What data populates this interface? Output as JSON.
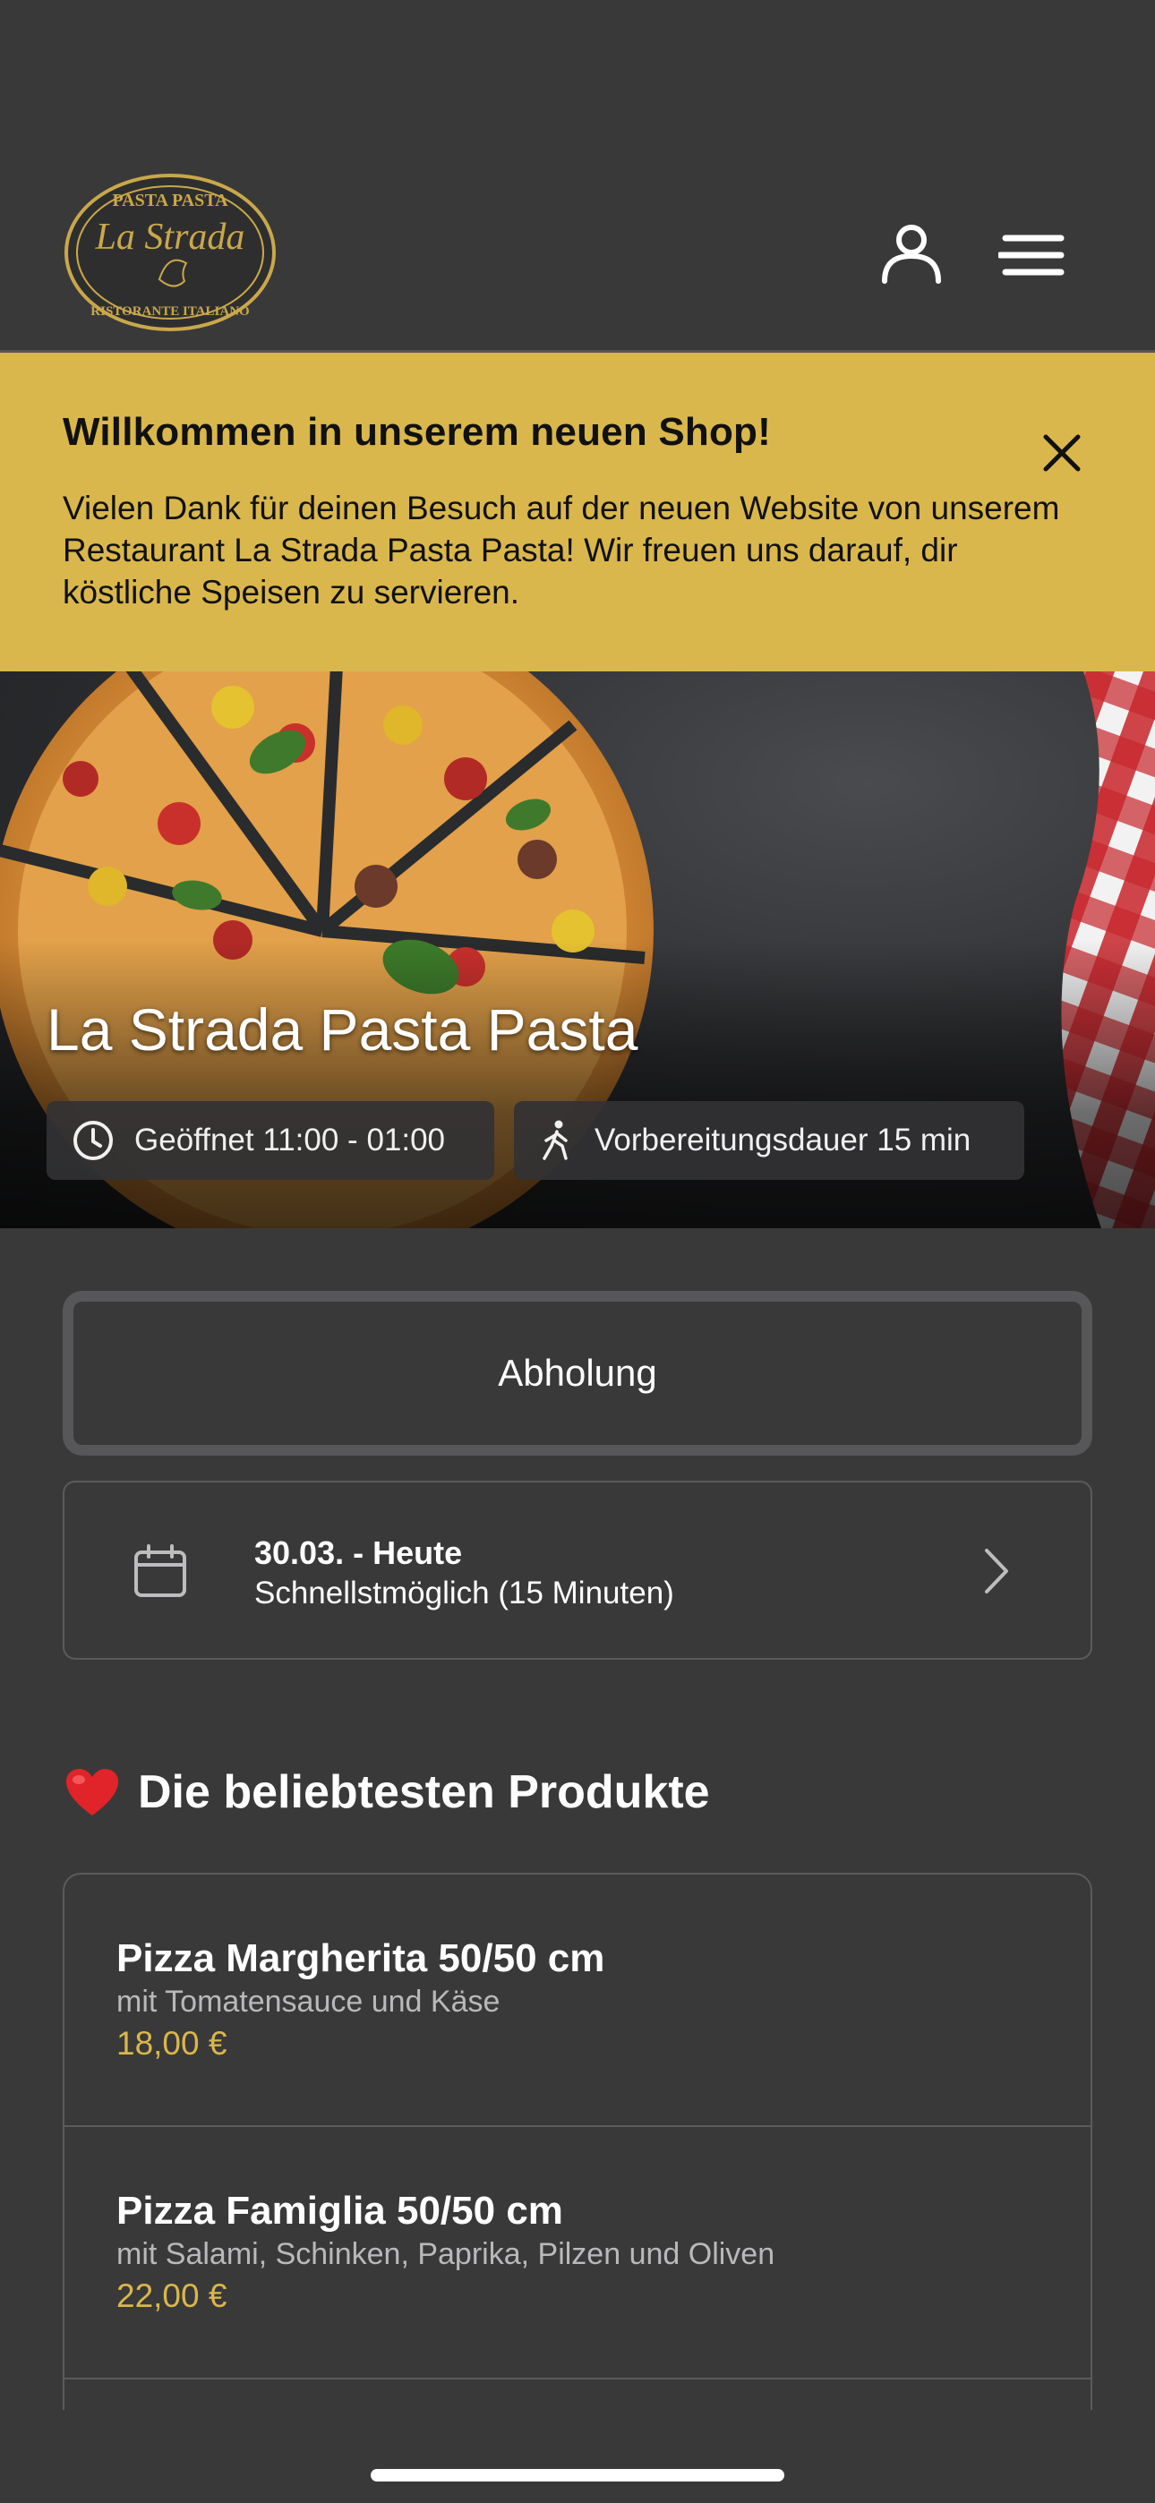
{
  "header": {
    "logo_text_top": "PASTA PASTA",
    "logo_text_script": "La Strada",
    "logo_text_bottom": "RISTORANTE ITALIANO",
    "account_icon": "user-icon",
    "menu_icon": "hamburger-menu-icon"
  },
  "banner": {
    "title": "Willkommen in unserem neuen Shop!",
    "text": "Vielen Dank für deinen Besuch auf der neuen Website von unserem Restaurant La Strada Pasta Pasta! Wir freuen uns darauf, dir köstliche Speisen zu servieren.",
    "close_icon": "close-icon",
    "background": "#d9b74c"
  },
  "hero": {
    "title": "La Strada Pasta Pasta",
    "opening_hours": "Geöffnet 11:00 - 01:00",
    "prep_time": "Vorbereitungsdauer 15 min"
  },
  "order": {
    "mode_label": "Abholung",
    "date_title": "30.03. - Heute",
    "date_sub": "Schnellstmöglich (15 Minuten)"
  },
  "popular": {
    "heading": "Die beliebtesten Produkte",
    "products": [
      {
        "name": "Pizza Margherita 50/50 cm",
        "description": "mit Tomatensauce und Käse",
        "price": "18,00 €"
      },
      {
        "name": "Pizza Famiglia 50/50 cm",
        "description": "mit Salami, Schinken, Paprika, Pilzen und Oliven",
        "price": "22,00 €"
      }
    ]
  },
  "colors": {
    "background": "#3a393a",
    "accent": "#d9b74c",
    "text": "#ffffff"
  }
}
